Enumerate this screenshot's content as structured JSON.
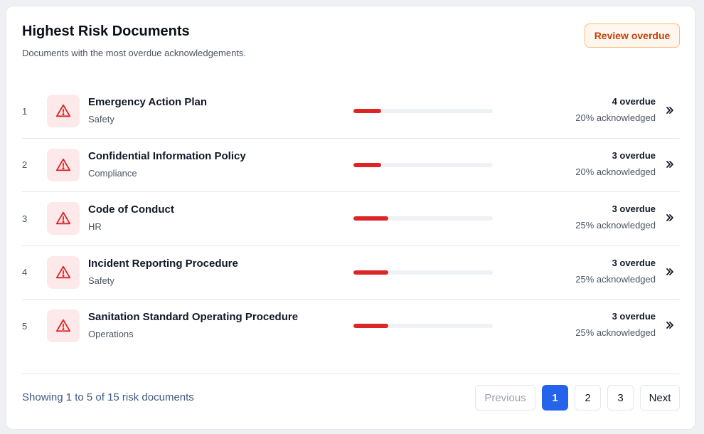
{
  "header": {
    "title": "Highest Risk Documents",
    "subtitle": "Documents with the most overdue acknowledgements.",
    "review_button": "Review overdue"
  },
  "colors": {
    "danger": "#dc2626",
    "warning_accent": "#c2410c",
    "primary": "#2563eb"
  },
  "documents": [
    {
      "rank": "1",
      "name": "Emergency Action Plan",
      "category": "Safety",
      "overdue": "4 overdue",
      "acknowledged": "20% acknowledged",
      "progress": 0.2,
      "icon": "warning-triangle-icon"
    },
    {
      "rank": "2",
      "name": "Confidential Information Policy",
      "category": "Compliance",
      "overdue": "3 overdue",
      "acknowledged": "20% acknowledged",
      "progress": 0.2,
      "icon": "warning-triangle-icon"
    },
    {
      "rank": "3",
      "name": "Code of Conduct",
      "category": "HR",
      "overdue": "3 overdue",
      "acknowledged": "25% acknowledged",
      "progress": 0.25,
      "icon": "warning-triangle-icon"
    },
    {
      "rank": "4",
      "name": "Incident Reporting Procedure",
      "category": "Safety",
      "overdue": "3 overdue",
      "acknowledged": "25% acknowledged",
      "progress": 0.25,
      "icon": "warning-triangle-icon"
    },
    {
      "rank": "5",
      "name": "Sanitation Standard Operating Procedure",
      "category": "Operations",
      "overdue": "3 overdue",
      "acknowledged": "25% acknowledged",
      "progress": 0.25,
      "icon": "warning-triangle-icon"
    }
  ],
  "footer": {
    "showing": "Showing 1 to 5 of 15 risk documents",
    "previous": "Previous",
    "pages": [
      "1",
      "2",
      "3"
    ],
    "current_page": "1",
    "next": "Next"
  }
}
